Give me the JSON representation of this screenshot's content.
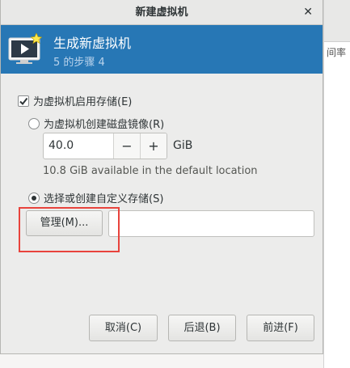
{
  "background_window": {
    "header_fragment": "间率"
  },
  "dialog": {
    "title": "新建虚拟机",
    "close_glyph": "✕"
  },
  "banner": {
    "heading": "生成新虚拟机",
    "step": "5 的步骤 4",
    "colors": {
      "background": "#2777b5"
    }
  },
  "storage": {
    "enable_label": "为虚拟机启用存储(E)",
    "enable_checked": true,
    "create_disk_label": "为虚拟机创建磁盘镜像(R)",
    "create_disk_selected": false,
    "disk_size_value": "40.0",
    "decrement_glyph": "−",
    "increment_glyph": "+",
    "unit": "GiB",
    "available_hint": "10.8 GiB available in the default location",
    "custom_label": "选择或创建自定义存储(S)",
    "custom_selected": true,
    "manage_button": "管理(M)...",
    "path_value": ""
  },
  "footer": {
    "cancel": "取消(C)",
    "back": "后退(B)",
    "forward": "前进(F)"
  },
  "icons": {
    "banner": "vm-monitor-with-star-icon",
    "checkbox": "checkmark-icon",
    "radio": "radio-dot-icon"
  },
  "annotation": {
    "highlight_color": "#e8433c"
  }
}
